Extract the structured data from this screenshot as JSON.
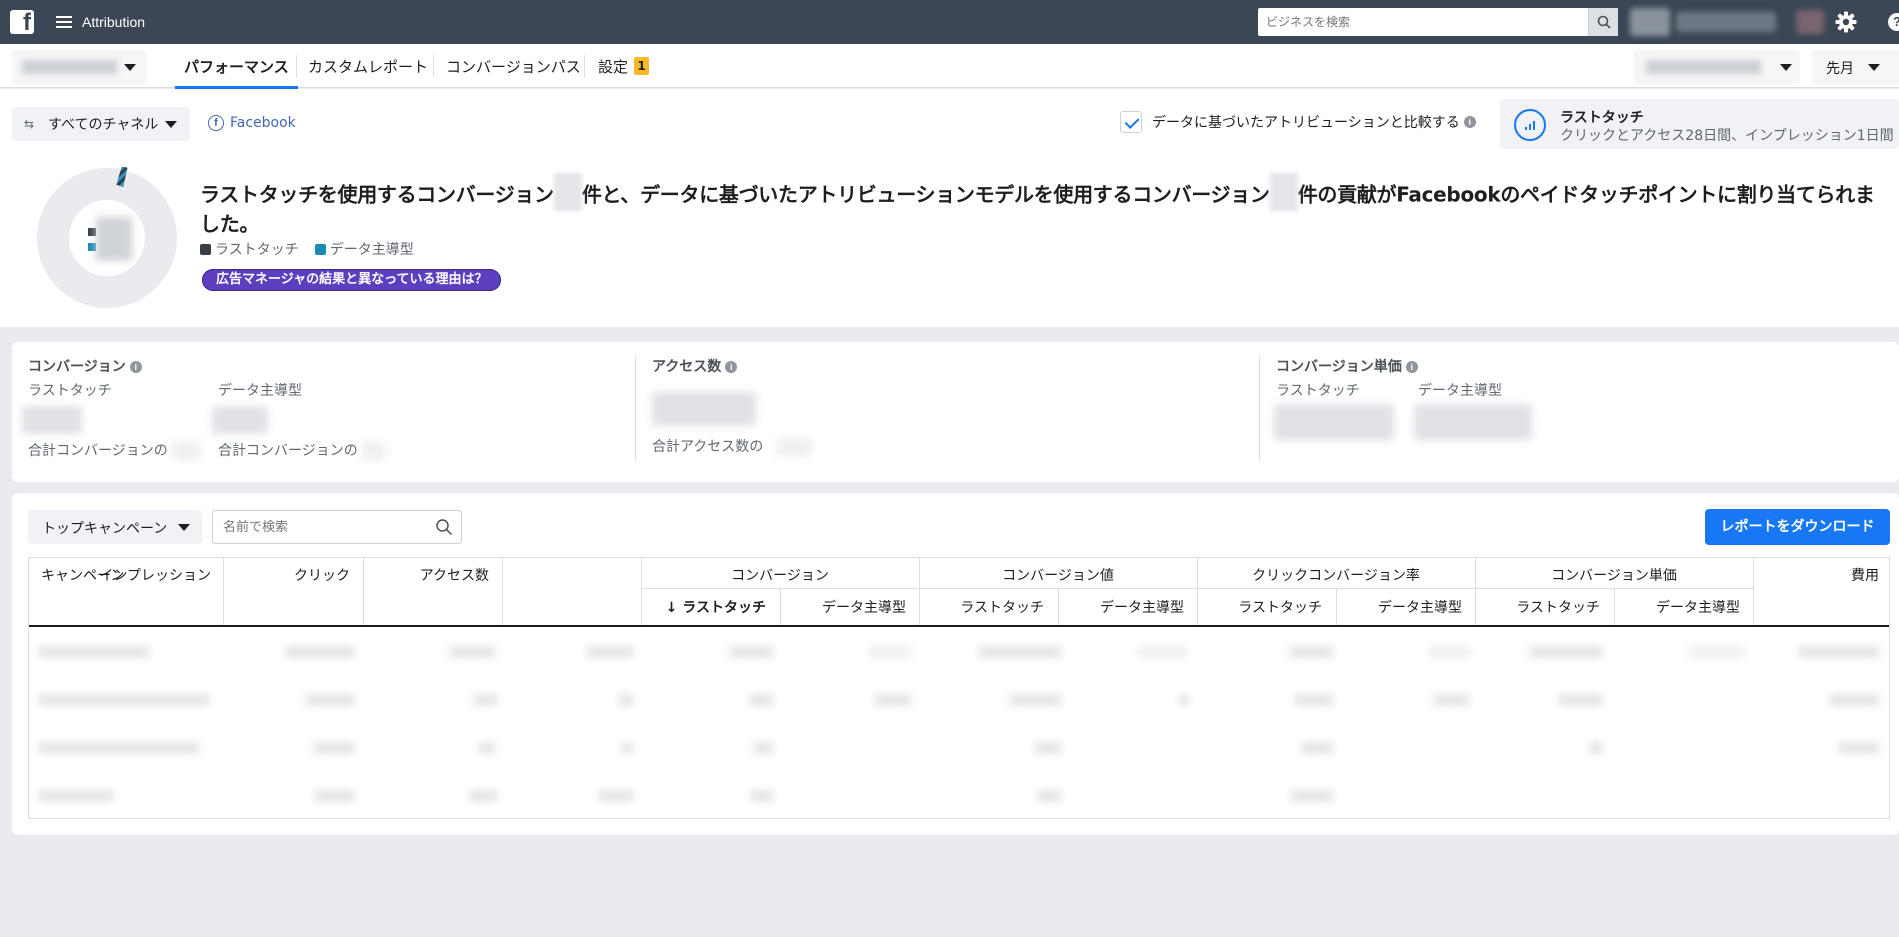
{
  "app": {
    "title": "Attribution"
  },
  "topbar": {
    "search_placeholder": "ビジネスを検索"
  },
  "tabs": [
    {
      "label": "パフォーマンス"
    },
    {
      "label": "カスタムレポート"
    },
    {
      "label": "コンバージョンパス"
    },
    {
      "label": "設定",
      "badge": "1"
    }
  ],
  "date_range": {
    "value": "先月"
  },
  "filters": {
    "channel": "すべてのチャネル",
    "platform": "Facebook"
  },
  "compare": {
    "label": "データに基づいたアトリビューションと比較する",
    "checked": true
  },
  "model": {
    "title": "ラストタッチ",
    "subtitle": "クリックとアクセス28日間、インプレッション1日間"
  },
  "summary": {
    "headline_part1": "ラストタッチを使用するコンバージョン",
    "headline_part2": "件と、データに基づいたアトリビューションモデルを使用するコンバージョン",
    "headline_part3": "件の貢献がFacebookのペイドタッチポイントに割り当てられました。",
    "legend": [
      "ラストタッチ",
      "データ主導型"
    ],
    "reason_button": "広告マネージャの結果と異なっている理由は？"
  },
  "metrics": {
    "conversions": {
      "title": "コンバージョン",
      "col1": "ラストタッチ",
      "col2": "データ主導型",
      "foot1": "合計コンバージョンの",
      "foot2": "合計コンバージョンの"
    },
    "visits": {
      "title": "アクセス数",
      "foot": "合計アクセス数の"
    },
    "cpa": {
      "title": "コンバージョン単価",
      "col1": "ラストタッチ",
      "col2": "データ主導型"
    }
  },
  "table": {
    "campaign_select": "トップキャンペーン",
    "search_placeholder": "名前で検索",
    "download_button": "レポートをダウンロード",
    "headers": {
      "campaign": "キャンペーン",
      "impressions": "インプレッション",
      "clicks": "クリック",
      "visits": "アクセス数",
      "conversions": "コンバージョン",
      "conversion_value": "コンバージョン値",
      "click_cvr": "クリックコンバージョン率",
      "cpa": "コンバージョン単価",
      "cost": "費用",
      "sub_last_touch": "ラストタッチ",
      "sub_sorted_last_touch": "↓ ラストタッチ",
      "sub_data_driven": "データ主導型"
    }
  },
  "colors": {
    "accent": "#1877f2",
    "topbar": "#3b4754",
    "last_touch": "#3a3f47",
    "data_driven": "#1b8bb4",
    "pill": "#5c3fbf"
  }
}
